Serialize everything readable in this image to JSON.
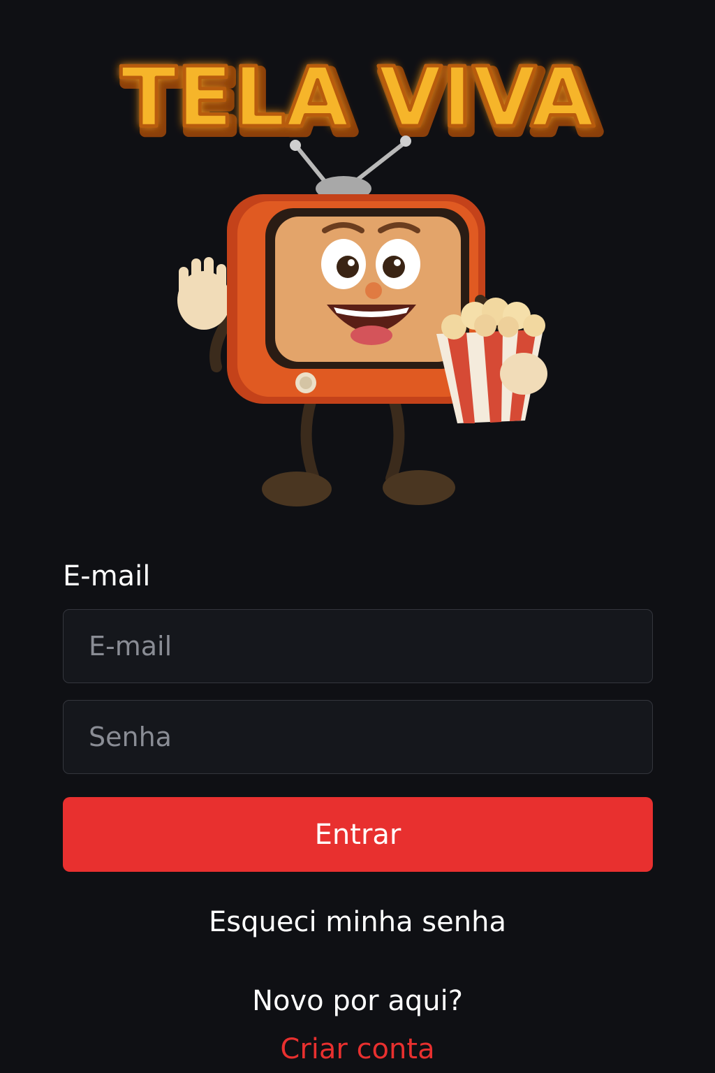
{
  "app": {
    "logo_text": "TELA VIVA",
    "logo_color": "#f6b52a",
    "logo_outline_color": "#8a3f0a"
  },
  "login_form": {
    "email_label": "E-mail",
    "email_placeholder": "E-mail",
    "password_placeholder": "Senha",
    "submit_label": "Entrar",
    "forgot_password_label": "Esqueci minha senha",
    "new_user_text": "Novo por aqui?",
    "create_account_label": "Criar conta"
  },
  "theme": {
    "background": "#0f1014",
    "input_background": "#15171c",
    "accent": "#e8302f"
  },
  "mascot": {
    "icon": "tv-mascot-with-popcorn-icon"
  }
}
